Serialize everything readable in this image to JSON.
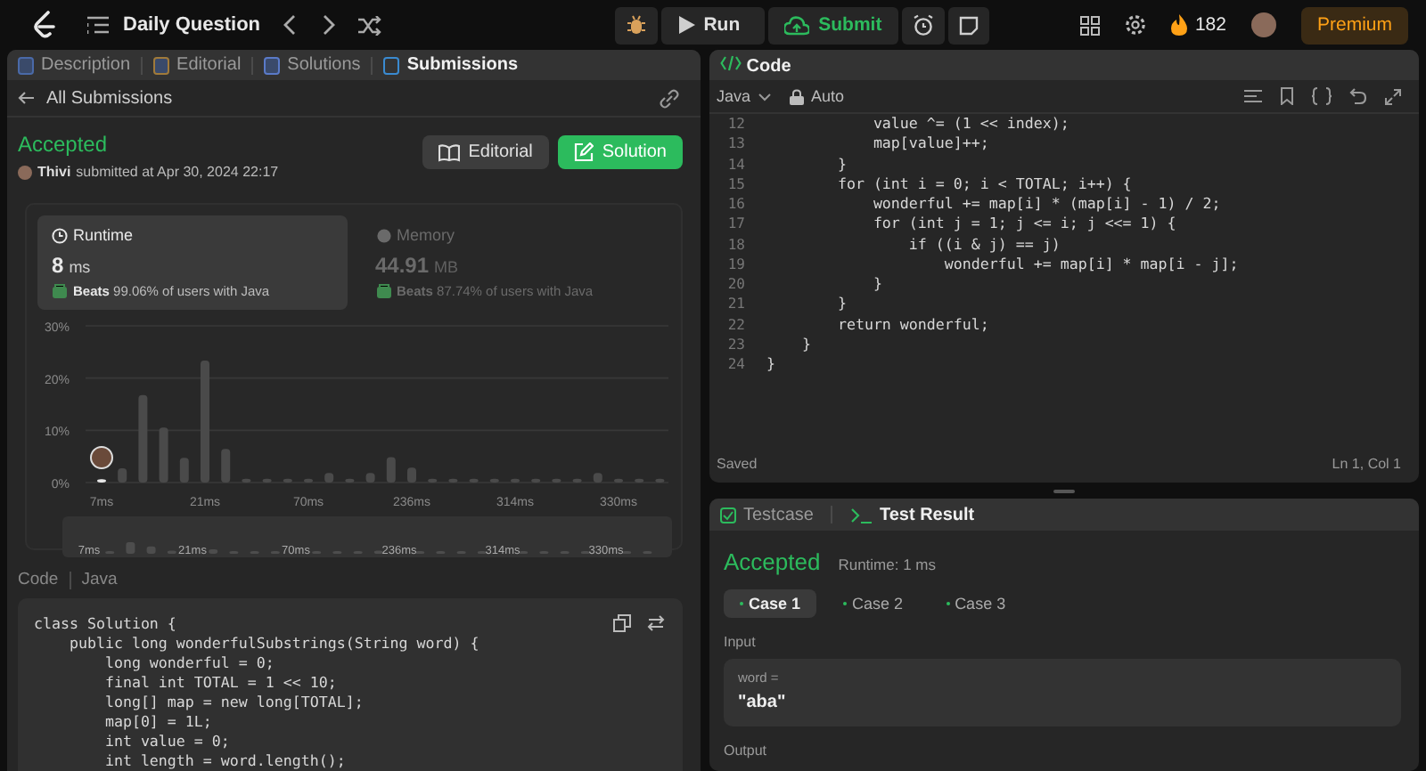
{
  "top_bar": {
    "title": "Daily Question",
    "run": "Run",
    "submit": "Submit",
    "streak": "182",
    "premium": "Premium"
  },
  "left_tabs": [
    {
      "label": "Description",
      "selected": false
    },
    {
      "label": "Editorial",
      "selected": false
    },
    {
      "label": "Solutions",
      "selected": false
    },
    {
      "label": "Submissions",
      "selected": true
    }
  ],
  "back_link": "All Submissions",
  "submission": {
    "status": "Accepted",
    "user": "Thivi",
    "submitted": "submitted at Apr 30, 2024 22:17",
    "editorial_button": "Editorial",
    "solution_button": "Solution"
  },
  "metrics": [
    {
      "kind": "runtime",
      "title": "Runtime",
      "value": "8",
      "unit": "ms",
      "beats": "**Beats** 99.06% of users with Java",
      "selected": true
    },
    {
      "kind": "memory",
      "title": "Memory",
      "value": "44.91",
      "unit": "MB",
      "beats": "**Beats** 87.74% of users with Java",
      "selected": false
    }
  ],
  "chart_data": {
    "type": "bar",
    "ylim": [
      0,
      30
    ],
    "yticks": [
      {
        "value": 0,
        "label": "0%"
      },
      {
        "value": 10,
        "label": "10%"
      },
      {
        "value": 20,
        "label": "20%"
      },
      {
        "value": 30,
        "label": "30%"
      }
    ],
    "categories": [
      "7ms",
      null,
      null,
      null,
      null,
      "21ms",
      null,
      null,
      null,
      null,
      "70ms",
      null,
      null,
      null,
      null,
      "236ms",
      null,
      null,
      null,
      null,
      "314ms",
      null,
      null,
      null,
      null,
      "330ms",
      null,
      null
    ],
    "values": [
      0.3,
      2.4,
      16.4,
      10.2,
      4.4,
      23,
      6.1,
      0.4,
      0.4,
      0.4,
      0.4,
      1.5,
      0.4,
      1.5,
      4.5,
      2.5,
      0.4,
      0.4,
      0.4,
      0.4,
      0.4,
      0.4,
      0.4,
      0.4,
      1.5,
      0.4,
      0.4,
      0.4
    ]
  },
  "navigator_labels": [
    "7ms",
    "21ms",
    "70ms",
    "236ms",
    "314ms",
    "330ms"
  ],
  "code_header": {
    "label": "Code",
    "language": "Java"
  },
  "solution_code": [
    "class Solution {",
    "    public long wonderfulSubstrings(String word) {",
    "        long wonderful = 0;",
    "        final int TOTAL = 1 << 10;",
    "        long[] map = new long[TOTAL];",
    "        map[0] = 1L;",
    "        int value = 0;",
    "        int length = word.length();"
  ],
  "editor": {
    "title": "Code",
    "language": "Java",
    "mode": "Auto",
    "status": "Saved",
    "cursor": "Ln 1, Col 1",
    "lines": [
      {
        "number": "12",
        "text": "            value ^= (1 << index);"
      },
      {
        "number": "13",
        "text": "            map[value]++;"
      },
      {
        "number": "14",
        "text": "        }"
      },
      {
        "number": "15",
        "text": "        for (int i = 0; i < TOTAL; i++) {"
      },
      {
        "number": "16",
        "text": "            wonderful += map[i] * (map[i] - 1) / 2;"
      },
      {
        "number": "17",
        "text": "            for (int j = 1; j <= i; j <<= 1) {"
      },
      {
        "number": "18",
        "text": "                if ((i & j) == j)"
      },
      {
        "number": "19",
        "text": "                    wonderful += map[i] * map[i - j];"
      },
      {
        "number": "20",
        "text": "            }"
      },
      {
        "number": "21",
        "text": "        }"
      },
      {
        "number": "22",
        "text": "        return wonderful;"
      },
      {
        "number": "23",
        "text": "    }"
      },
      {
        "number": "24",
        "text": "}"
      }
    ]
  },
  "result_tabs": [
    {
      "label": "Testcase",
      "selected": false
    },
    {
      "label": "Test Result",
      "selected": true
    }
  ],
  "result": {
    "status": "Accepted",
    "runtime": "Runtime: 1 ms",
    "cases": [
      {
        "label": "Case 1",
        "selected": true
      },
      {
        "label": "Case 2",
        "selected": false
      },
      {
        "label": "Case 3",
        "selected": false
      }
    ],
    "input_label": "Input",
    "param_name": "word =",
    "param_value": "\"aba\"",
    "output_label": "Output"
  }
}
